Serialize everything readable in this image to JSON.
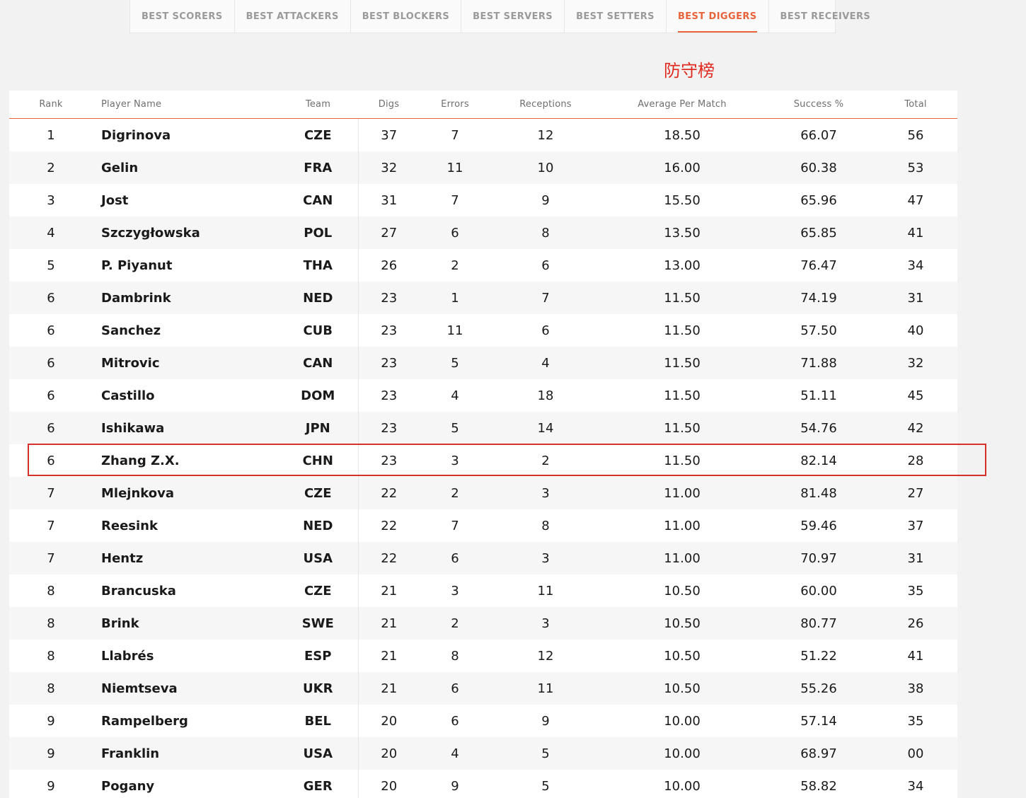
{
  "tabs": [
    {
      "label": "BEST SCORERS",
      "active": false
    },
    {
      "label": "BEST ATTACKERS",
      "active": false
    },
    {
      "label": "BEST BLOCKERS",
      "active": false
    },
    {
      "label": "BEST SERVERS",
      "active": false
    },
    {
      "label": "BEST SETTERS",
      "active": false
    },
    {
      "label": "BEST DIGGERS",
      "active": true
    },
    {
      "label": "BEST RECEIVERS",
      "active": false
    }
  ],
  "annotation": "防守榜",
  "colors": {
    "accent": "#e8633a",
    "highlight_box": "#d5302a",
    "annotation": "#e02b20"
  },
  "table": {
    "columns": [
      "Rank",
      "Player Name",
      "Team",
      "Digs",
      "Errors",
      "Receptions",
      "Average Per Match",
      "Success %",
      "Total"
    ],
    "rows": [
      [
        "1",
        "Digrinova",
        "CZE",
        "37",
        "7",
        "12",
        "18.50",
        "66.07",
        "56"
      ],
      [
        "2",
        "Gelin",
        "FRA",
        "32",
        "11",
        "10",
        "16.00",
        "60.38",
        "53"
      ],
      [
        "3",
        "Jost",
        "CAN",
        "31",
        "7",
        "9",
        "15.50",
        "65.96",
        "47"
      ],
      [
        "4",
        "Szczygłowska",
        "POL",
        "27",
        "6",
        "8",
        "13.50",
        "65.85",
        "41"
      ],
      [
        "5",
        "P. Piyanut",
        "THA",
        "26",
        "2",
        "6",
        "13.00",
        "76.47",
        "34"
      ],
      [
        "6",
        "Dambrink",
        "NED",
        "23",
        "1",
        "7",
        "11.50",
        "74.19",
        "31"
      ],
      [
        "6",
        "Sanchez",
        "CUB",
        "23",
        "11",
        "6",
        "11.50",
        "57.50",
        "40"
      ],
      [
        "6",
        "Mitrovic",
        "CAN",
        "23",
        "5",
        "4",
        "11.50",
        "71.88",
        "32"
      ],
      [
        "6",
        "Castillo",
        "DOM",
        "23",
        "4",
        "18",
        "11.50",
        "51.11",
        "45"
      ],
      [
        "6",
        "Ishikawa",
        "JPN",
        "23",
        "5",
        "14",
        "11.50",
        "54.76",
        "42"
      ],
      [
        "6",
        "Zhang Z.X.",
        "CHN",
        "23",
        "3",
        "2",
        "11.50",
        "82.14",
        "28"
      ],
      [
        "7",
        "Mlejnkova",
        "CZE",
        "22",
        "2",
        "3",
        "11.00",
        "81.48",
        "27"
      ],
      [
        "7",
        "Reesink",
        "NED",
        "22",
        "7",
        "8",
        "11.00",
        "59.46",
        "37"
      ],
      [
        "7",
        "Hentz",
        "USA",
        "22",
        "6",
        "3",
        "11.00",
        "70.97",
        "31"
      ],
      [
        "8",
        "Brancuska",
        "CZE",
        "21",
        "3",
        "11",
        "10.50",
        "60.00",
        "35"
      ],
      [
        "8",
        "Brink",
        "SWE",
        "21",
        "2",
        "3",
        "10.50",
        "80.77",
        "26"
      ],
      [
        "8",
        "Llabrés",
        "ESP",
        "21",
        "8",
        "12",
        "10.50",
        "51.22",
        "41"
      ],
      [
        "8",
        "Niemtseva",
        "UKR",
        "21",
        "6",
        "11",
        "10.50",
        "55.26",
        "38"
      ],
      [
        "9",
        "Rampelberg",
        "BEL",
        "20",
        "6",
        "9",
        "10.00",
        "57.14",
        "35"
      ],
      [
        "9",
        "Franklin",
        "USA",
        "20",
        "4",
        "5",
        "10.00",
        "68.97",
        "00"
      ],
      [
        "9",
        "Pogany",
        "GER",
        "20",
        "9",
        "5",
        "10.00",
        "58.82",
        "34"
      ]
    ],
    "highlighted_player": "Zhang Z.X."
  }
}
